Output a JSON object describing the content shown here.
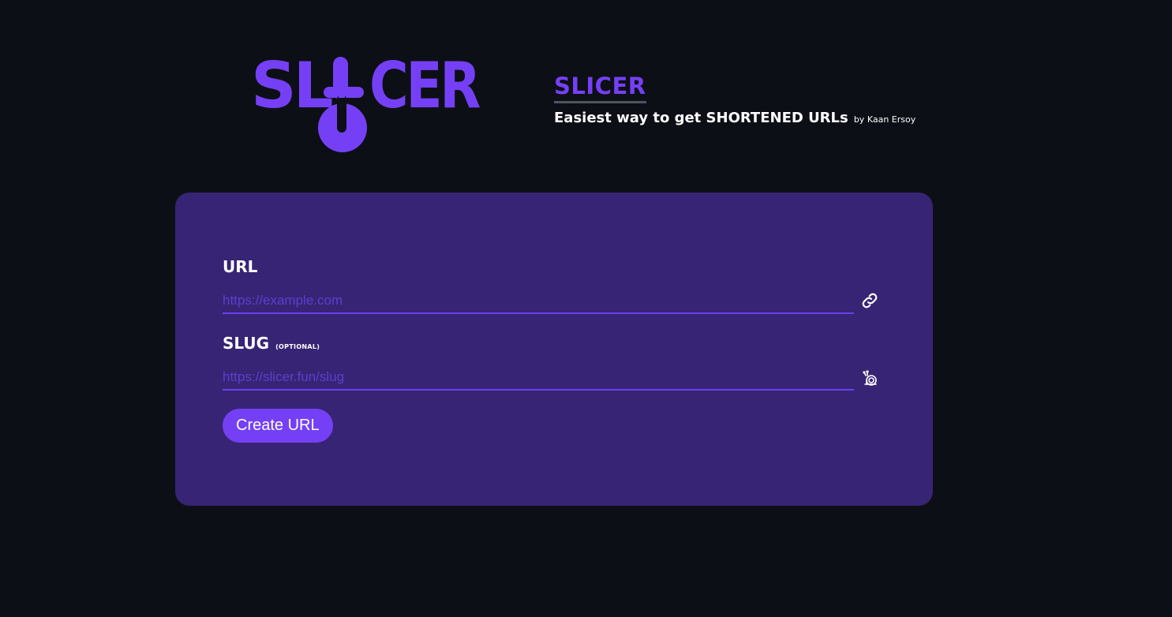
{
  "brand": {
    "logo_text": "SLICER",
    "title": "SLICER",
    "tagline": "Easiest way to get SHORTENED URLs",
    "author": "by Kaan Ersoy"
  },
  "form": {
    "url_label": "URL",
    "url_placeholder": "https://example.com",
    "url_value": "",
    "url_icon": "link-icon",
    "slug_label": "SLUG",
    "slug_optional": "(OPTIONAL)",
    "slug_placeholder": "https://slicer.fun/slug",
    "slug_value": "",
    "slug_icon": "snail-icon",
    "submit_label": "Create URL"
  },
  "colors": {
    "background": "#0d0f16",
    "accent": "#7540f5",
    "card": "#372474",
    "input_underline": "#6a3ff0",
    "title_underline": "#4f5463"
  }
}
